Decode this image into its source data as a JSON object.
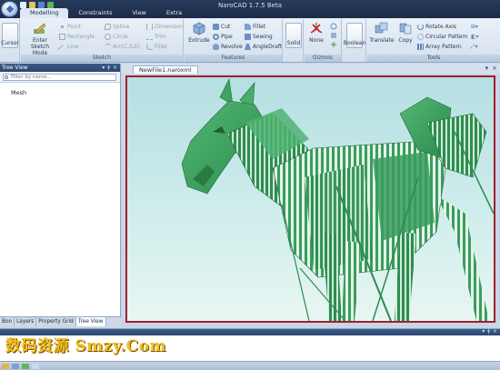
{
  "window": {
    "title": "NaroCAD 1.7.5 Beta"
  },
  "ribbon_tabs": [
    {
      "label": "Modelling",
      "active": true
    },
    {
      "label": "Constraints",
      "active": false
    },
    {
      "label": "View",
      "active": false
    },
    {
      "label": "Extra",
      "active": false
    }
  ],
  "groups": {
    "cursor": {
      "label": "Cursor"
    },
    "sketch": {
      "label": "Sketch",
      "enter": "Enter Sketch Mode",
      "point": "Point",
      "rectangle": "Rectangle",
      "line": "Line",
      "spline": "Spline",
      "circle": "Circle",
      "arc": "Arc(C,S,E)",
      "dimension": "Dimension",
      "trim": "Trim",
      "fillet": "Fillet"
    },
    "features": {
      "label": "Features",
      "extrude": "Extrude",
      "cut": "Cut",
      "pipe": "Pipe",
      "revolve": "Revolve",
      "fillet": "Fillet",
      "sewing": "Sewing",
      "angledraft": "AngleDraft"
    },
    "solid": {
      "label": "Solid"
    },
    "gizmos": {
      "label": "Gizmos",
      "none": "None"
    },
    "boolean": {
      "label": "Boolean"
    },
    "tools": {
      "label": "Tools",
      "translate": "Translate",
      "copy": "Copy",
      "rotate_axis": "Rotate Axis",
      "circular_pattern": "Circular Pattern",
      "array_pattern": "Array Pattern"
    }
  },
  "tree_view": {
    "title": "Tree View",
    "filter_placeholder": "Filter by name...",
    "items": [
      "Mesh"
    ]
  },
  "left_bottom_tabs": [
    {
      "label": "Boo",
      "active": false
    },
    {
      "label": "Layers",
      "active": false
    },
    {
      "label": "Property Grid",
      "active": false
    },
    {
      "label": "Tree View",
      "active": true
    }
  ],
  "document": {
    "tab_label": "NewFile1.naroxml"
  },
  "watermark": {
    "text": "数码资源 Smzy.Com"
  },
  "colors": {
    "viewport_border": "#a0202a",
    "model_green": "#2f9a55",
    "title_bar": "#263b5c"
  }
}
